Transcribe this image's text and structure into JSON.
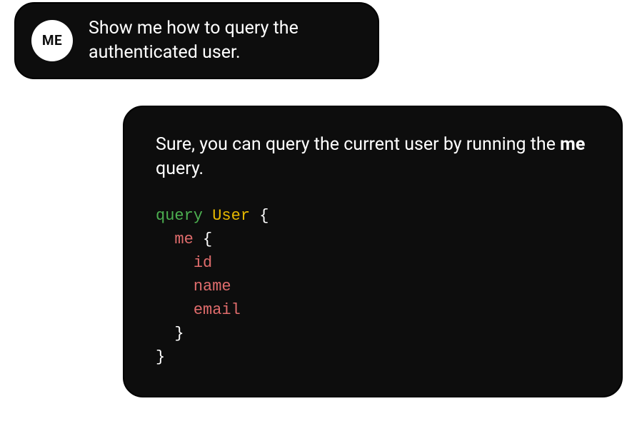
{
  "user_message": {
    "avatar_text": "ME",
    "text": "Show me how to query the authenticated user."
  },
  "assistant_message": {
    "text_before_bold": "Sure, you can query the current user by running the ",
    "text_bold": "me",
    "text_after_bold": " query.",
    "code": {
      "keyword": "query",
      "operation_name": "User",
      "brace_open": "{",
      "field_me": "me",
      "field_id": "id",
      "field_name": "name",
      "field_email": "email",
      "brace_close": "}",
      "indent1": "  ",
      "indent2": "    "
    }
  }
}
